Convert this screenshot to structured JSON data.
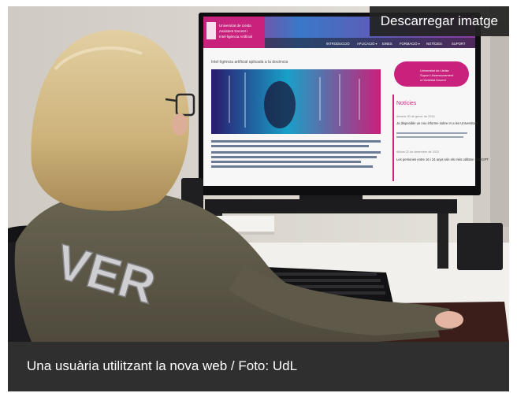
{
  "photo": {
    "download_label": "Descarregar imatge",
    "caption": "Una usuària utilitzant la nova web / Foto: UdL"
  },
  "screen": {
    "logo_lines": [
      "Universitat de Lleida",
      "Assistent Docent i",
      "Intel·ligència Artificial"
    ],
    "nav": [
      "INTRODUCCIÓ",
      "APLICACIÓ ▾",
      "EINES",
      "FORMACIÓ ▾",
      "NOTÍCIES",
      "SUPORT"
    ],
    "page_heading": "Intel·ligència artificial aplicada a la docència",
    "side_logo_lines": [
      "Universitat de Lleida",
      "Suport i Assessorament",
      "a l'Activitat Docent"
    ],
    "news_title": "Notícies",
    "news": [
      {
        "date": "dimarts 30 de gener de 2024",
        "title": "Ja disponible un nou informe sobre IA a les Universitats"
      },
      {
        "date": "dilluns 22 de desembre de 2023",
        "title": "Les persones entre 16 i 24 anys són els més utilitzen ChatGPT"
      }
    ]
  },
  "sweater_text": "VER",
  "colors": {
    "brand_magenta": "#c8227d",
    "caption_bg": "#2f2f2f",
    "button_bg": "#222222"
  }
}
